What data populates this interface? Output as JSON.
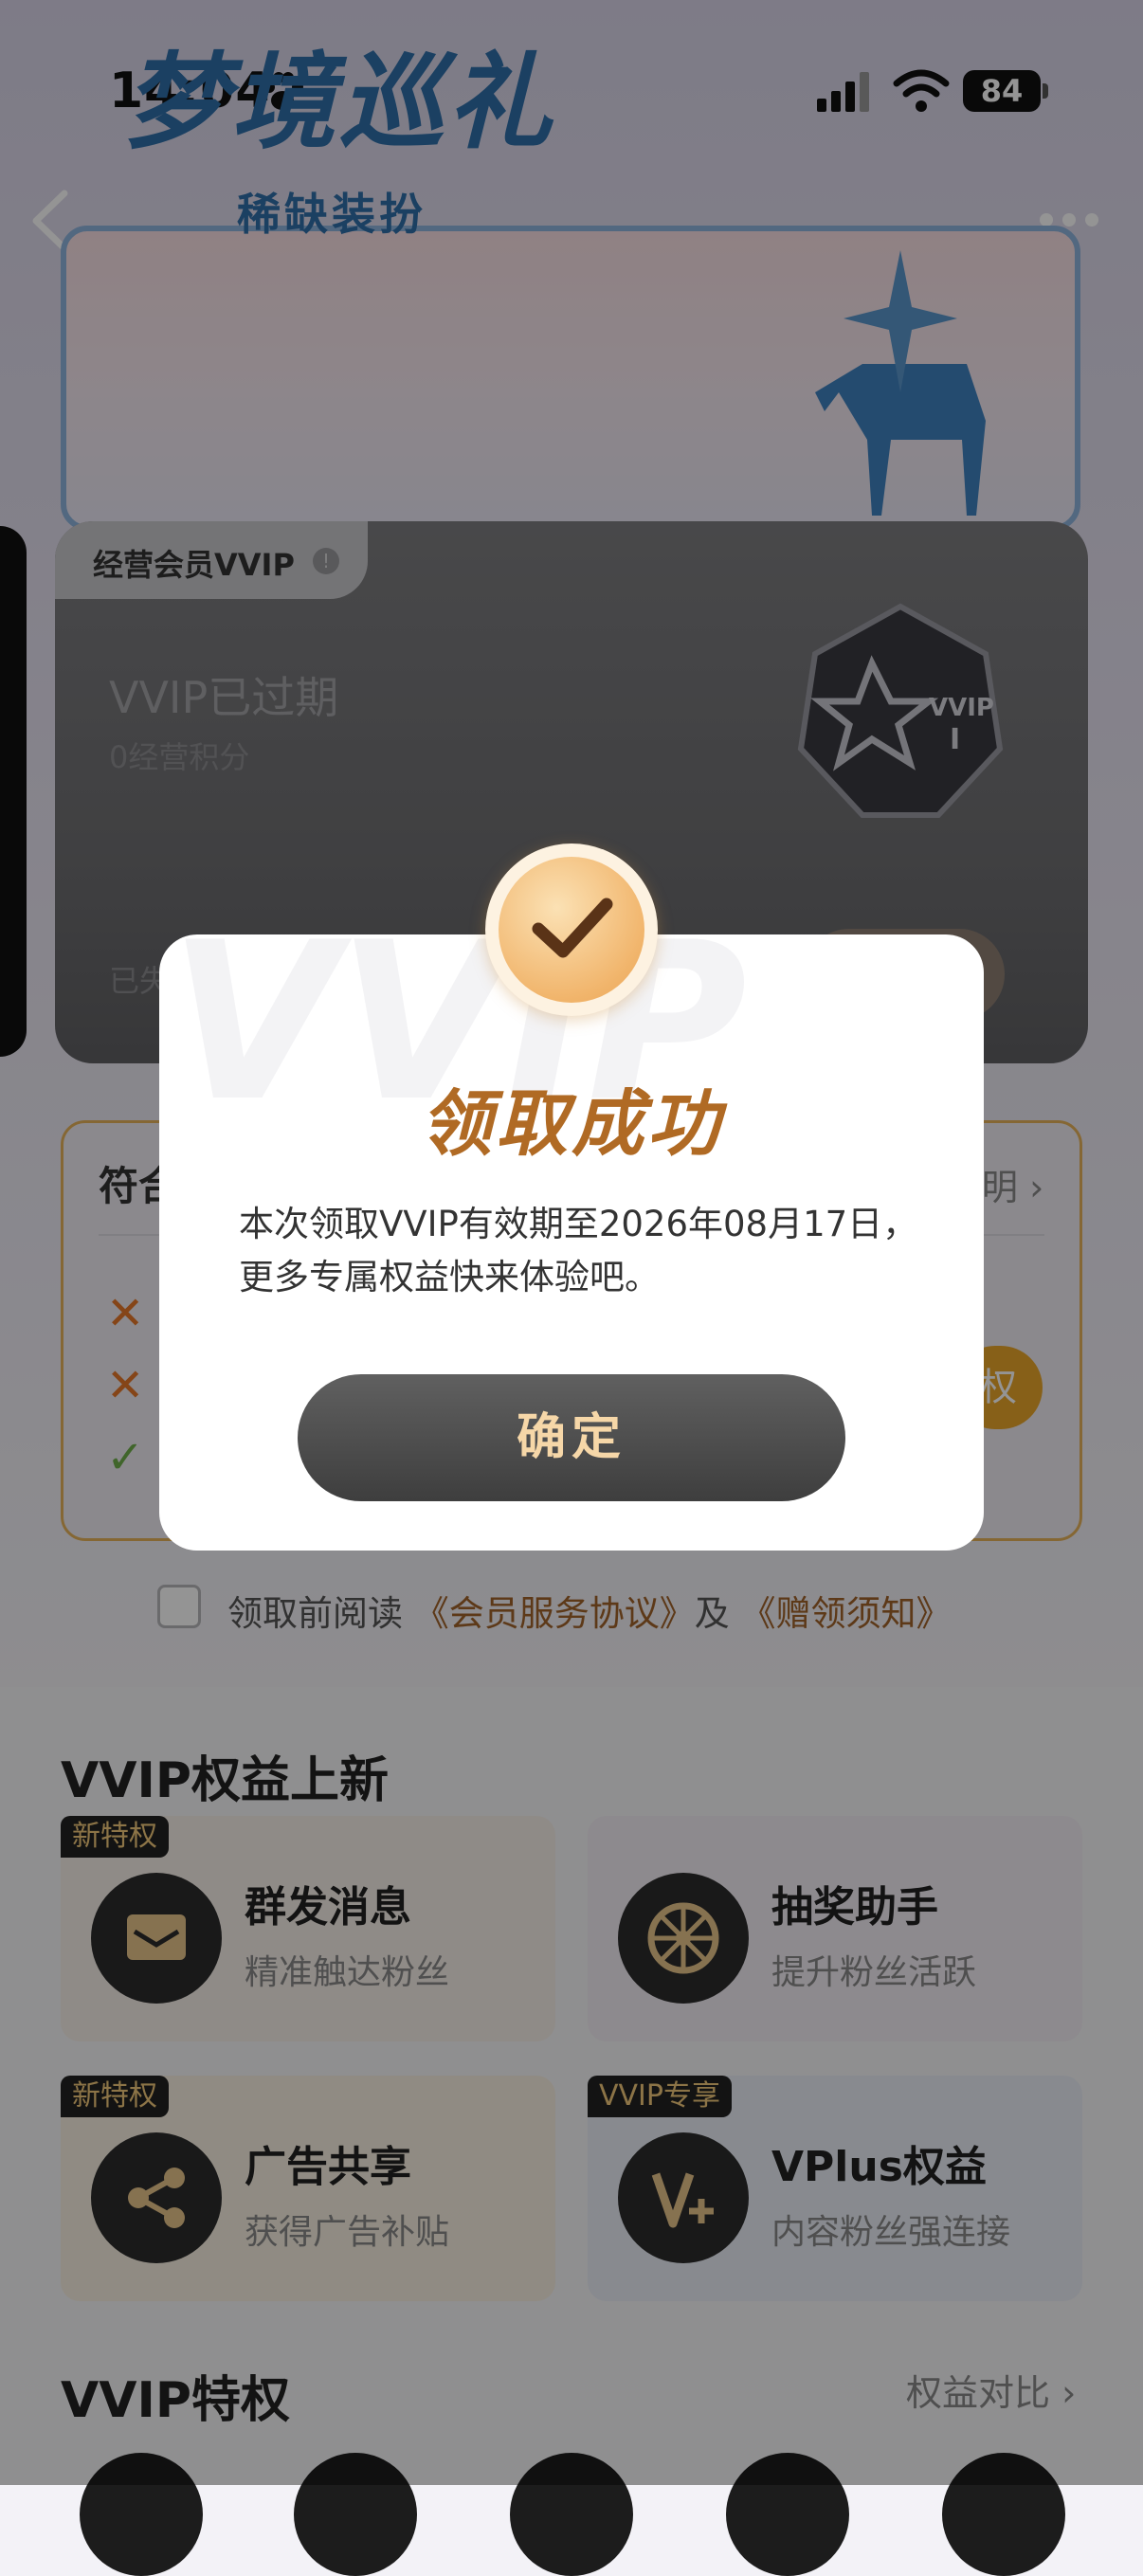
{
  "status_bar": {
    "time": "14:04",
    "battery": "84"
  },
  "banner": {
    "title": "梦境巡礼",
    "subtitle": "稀缺装扮"
  },
  "vip_card": {
    "tab_label": "经营会员VVIP",
    "status": "VVIP已过期",
    "points": "0经营积分",
    "bottom_text": "已失",
    "badge_label": "VVIP",
    "badge_level": "I"
  },
  "eligibility": {
    "title": "符合",
    "link": "明",
    "items": [
      "✕",
      "✕",
      "✓"
    ],
    "button": "权"
  },
  "agreement": {
    "prefix": "领取前阅读",
    "link1": "《会员服务协议》",
    "middle": "及",
    "link2": "《赠领须知》"
  },
  "benefits_section": {
    "title": "VVIP权益上新",
    "items": [
      {
        "name": "群发消息",
        "desc": "精准触达粉丝",
        "tag": "新特权",
        "icon": "message-icon"
      },
      {
        "name": "抽奖助手",
        "desc": "提升粉丝活跃",
        "tag": "",
        "icon": "lottery-wheel-icon"
      },
      {
        "name": "广告共享",
        "desc": "获得广告补贴",
        "tag": "新特权",
        "icon": "share-icon"
      },
      {
        "name": "VPlus权益",
        "desc": "内容粉丝强连接",
        "tag": "VVIP专享",
        "icon": "vplus-icon"
      }
    ]
  },
  "privileges_section": {
    "title": "VVIP特权",
    "compare_link": "权益对比"
  },
  "modal": {
    "title": "领取成功",
    "message": "本次领取VVIP有效期至2026年08月17日，更多专属权益快来体验吧。",
    "confirm": "确定",
    "watermark": "VVIP"
  },
  "colors": {
    "accent": "#b06a24",
    "gold": "#e9a52a",
    "dark": "#2b2b2b"
  }
}
